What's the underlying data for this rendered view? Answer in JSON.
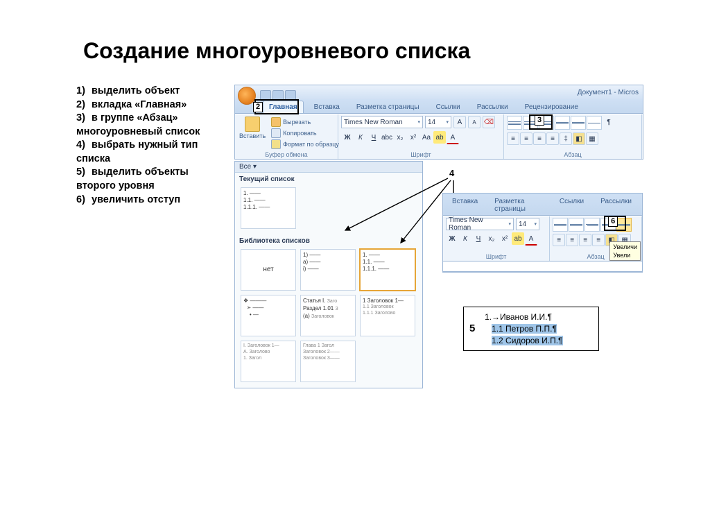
{
  "title": "Создание многоуровневого списка",
  "instructions": [
    "выделить объект",
    "вкладка «Главная»",
    "в группе «Абзац» многоуровневый список",
    "выбрать нужный тип списка",
    "выделить объекты второго уровня",
    "увеличить отступ"
  ],
  "window": {
    "doc_title": "Документ1 - Micros"
  },
  "tabs": {
    "home": "Главная",
    "insert": "Вставка",
    "layout": "Разметка страницы",
    "refs": "Ссылки",
    "mail": "Рассылки",
    "review": "Рецензирование"
  },
  "clipboard": {
    "paste": "Вставить",
    "cut": "Вырезать",
    "copy": "Копировать",
    "fmt": "Формат по образцу",
    "group": "Буфер обмена"
  },
  "font": {
    "name": "Times New Roman",
    "size": "14",
    "group": "Шрифт"
  },
  "para": {
    "group": "Абзац"
  },
  "dropdown": {
    "all": "Все ▾",
    "current": "Текущий список",
    "library": "Библиотека списков",
    "none": "нет",
    "t1a": "1. ——",
    "t1b": "1.1. ——",
    "t1c": "1.1.1. ——",
    "t2a1": "1) ——",
    "t2a2": "a) ——",
    "t2a3": "    i) ——",
    "t2b1": "1. ——",
    "t2b2": "  1.1. ——",
    "t2b3": "  1.1.1. ——",
    "t3b1": "Статья I.",
    "t3b2": "Раздел 1.01",
    "t3b3": "(a)",
    "t3c1": "1 Заголовок 1—",
    "t3c2": "1.1 Заголовок",
    "t3c3": "1.1.1 Заголово",
    "t4a1": "I. Заголовок 1—",
    "t4a2": "  A. Заголово",
    "t4a3": "    1. Загол",
    "t4b1": "Глава 1 Загол",
    "t4b2": "Заголовок 2——",
    "t4b3": "Заголовок 3——",
    "tiny": "Заго"
  },
  "callouts": {
    "c2": "2",
    "c3": "3",
    "c4": "4",
    "c5": "5",
    "c6": "6"
  },
  "tooltip": "Увеличи",
  "tooltip2": "Увели",
  "sample": {
    "l1": "1.→Иванов И.И.¶",
    "l2": "1.1 Петров П.П.¶",
    "l3": "1.2 Сидоров И.П.¶"
  }
}
